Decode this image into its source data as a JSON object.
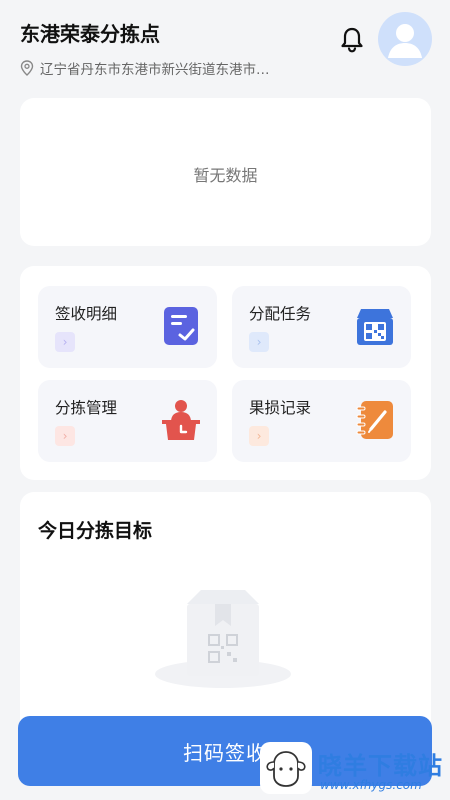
{
  "header": {
    "store_name": "东港荣泰分拣点",
    "address": "辽宁省丹东市东港市新兴街道东港市…",
    "icons": {
      "location": "map-pin-icon",
      "notification": "bell-icon",
      "avatar": "user-avatar-icon"
    }
  },
  "summary": {
    "empty_text": "暂无数据"
  },
  "menu": {
    "items": [
      {
        "label": "签收明细",
        "icon": "signed-list-icon",
        "color": "#5b63e0"
      },
      {
        "label": "分配任务",
        "icon": "qr-box-icon",
        "color": "#3d74dc"
      },
      {
        "label": "分拣管理",
        "icon": "sorting-worker-icon",
        "color": "#e2544d"
      },
      {
        "label": "果损记录",
        "icon": "notebook-pen-icon",
        "color": "#ee8a3c"
      }
    ],
    "chevron": "›"
  },
  "target": {
    "title": "今日分拣目标"
  },
  "scan": {
    "label": "扫码签收"
  },
  "watermark": {
    "text": "晓羊下载站",
    "url": "www.xfhygs.com"
  },
  "colors": {
    "accent": "#3f7fe6",
    "background": "#f4f5f7"
  }
}
